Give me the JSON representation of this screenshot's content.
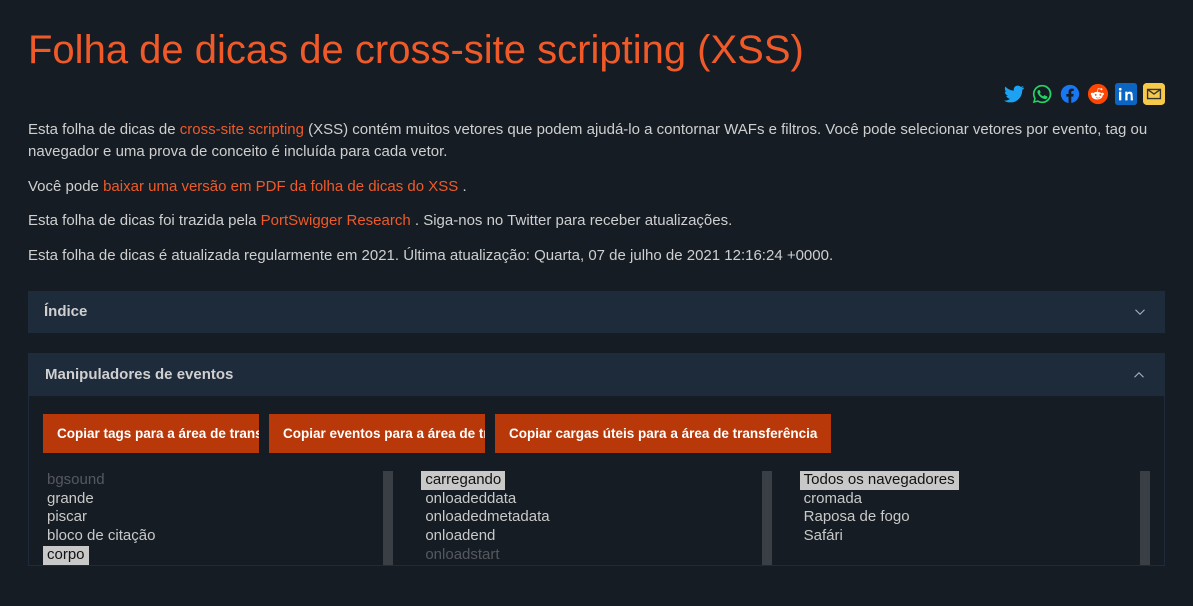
{
  "title": "Folha de dicas de cross-site scripting (XSS)",
  "share": {
    "twitter": "twitter-icon",
    "whatsapp": "whatsapp-icon",
    "facebook": "facebook-icon",
    "reddit": "reddit-icon",
    "linkedin": "linkedin-icon",
    "email": "email-icon"
  },
  "para1": {
    "pre": "Esta folha de dicas de ",
    "link": "cross-site scripting",
    "post": " (XSS) contém muitos vetores que podem ajudá-lo a contornar WAFs e filtros. Você pode selecionar vetores por evento, tag ou navegador e uma prova de conceito é incluída para cada vetor."
  },
  "para2": {
    "pre": "Você pode ",
    "link": "baixar uma versão em PDF da folha de dicas do XSS ",
    "post": "."
  },
  "para3": {
    "pre": "Esta folha de dicas foi trazida pela ",
    "link": "PortSwigger Research ",
    "post": ". Siga-nos no Twitter para receber atualizações."
  },
  "para4": "Esta folha de dicas é atualizada regularmente em 2021. Última atualização: Quarta, 07 de julho de 2021 12:16:24 +0000.",
  "accordion_index": "Índice",
  "section_handlers": "Manipuladores de eventos",
  "buttons": {
    "copy_tags": "Copiar tags para a área de transferência",
    "copy_events": "Copiar eventos para a área de transferência",
    "copy_payloads": "Copiar cargas úteis para a área de transferência"
  },
  "list_tags": [
    {
      "label": "bgsound",
      "selected": false,
      "faded": true
    },
    {
      "label": "grande",
      "selected": false
    },
    {
      "label": "piscar",
      "selected": false
    },
    {
      "label": "bloco de citação",
      "selected": false
    },
    {
      "label": "corpo",
      "selected": true
    }
  ],
  "list_events": [
    {
      "label": "carregando",
      "selected": true
    },
    {
      "label": "onloadeddata",
      "selected": false
    },
    {
      "label": "onloadedmetadata",
      "selected": false
    },
    {
      "label": "onloadend",
      "selected": false
    },
    {
      "label": "onloadstart",
      "selected": false,
      "faded": true
    }
  ],
  "list_browsers": [
    {
      "label": "Todos os navegadores",
      "selected": true
    },
    {
      "label": "cromada",
      "selected": false
    },
    {
      "label": "Raposa de fogo",
      "selected": false
    },
    {
      "label": "Safári",
      "selected": false
    }
  ]
}
